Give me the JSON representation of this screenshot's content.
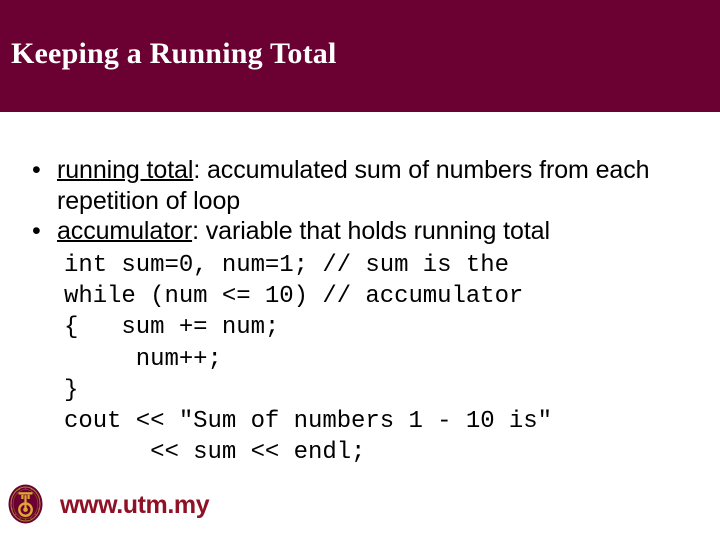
{
  "header": {
    "title": "Keeping a Running Total",
    "background_color": "#6b0032",
    "title_color": "#ffffff"
  },
  "content": {
    "bullets": [
      {
        "marker": "•",
        "term": "running total",
        "term_underlined": true,
        "rest": ": accumulated sum of numbers from each repetition of loop"
      },
      {
        "marker": "•",
        "term": "accumulator",
        "term_underlined": true,
        "rest": ": variable that holds running total"
      }
    ],
    "code": {
      "language": "cpp",
      "lines": [
        "int sum=0, num=1; // sum is the",
        "while (num <= 10) // accumulator",
        "{   sum += num;",
        "     num++;",
        "}",
        "cout << \"Sum of numbers 1 - 10 is\"",
        "      << sum << endl;"
      ]
    }
  },
  "footer": {
    "url": "www.utm.my",
    "url_color": "#8e1125",
    "logo": {
      "name": "utm-logo",
      "disc_color": "#6b0032",
      "emblem_color": "#e0a832",
      "ring_color": "#c8962c"
    }
  }
}
